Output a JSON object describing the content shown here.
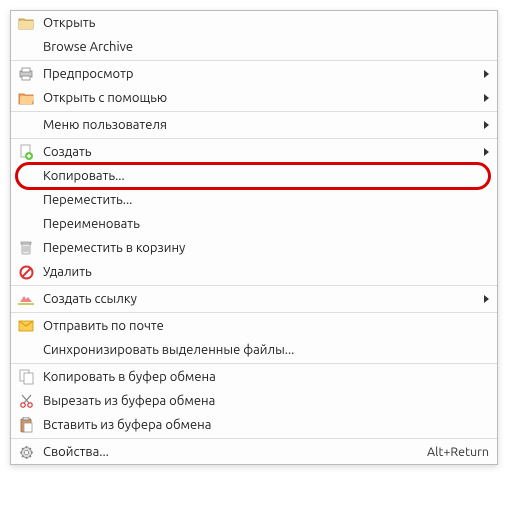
{
  "menu": {
    "open": "Открыть",
    "browse_archive": "Browse Archive",
    "preview": "Предпросмотр",
    "open_with": "Открыть с помощью",
    "user_menu": "Меню пользователя",
    "create": "Создать",
    "copy": "Копировать...",
    "move": "Переместить...",
    "rename": "Переименовать",
    "trash": "Переместить в корзину",
    "delete": "Удалить",
    "create_link": "Создать ссылку",
    "send_mail": "Отправить по почте",
    "sync_selected": "Синхронизировать выделенные файлы...",
    "copy_clip": "Копировать в буфер обмена",
    "cut_clip": "Вырезать из буфера обмена",
    "paste_clip": "Вставить из буфера обмена",
    "properties": "Свойства...",
    "properties_shortcut": "Alt+Return"
  }
}
